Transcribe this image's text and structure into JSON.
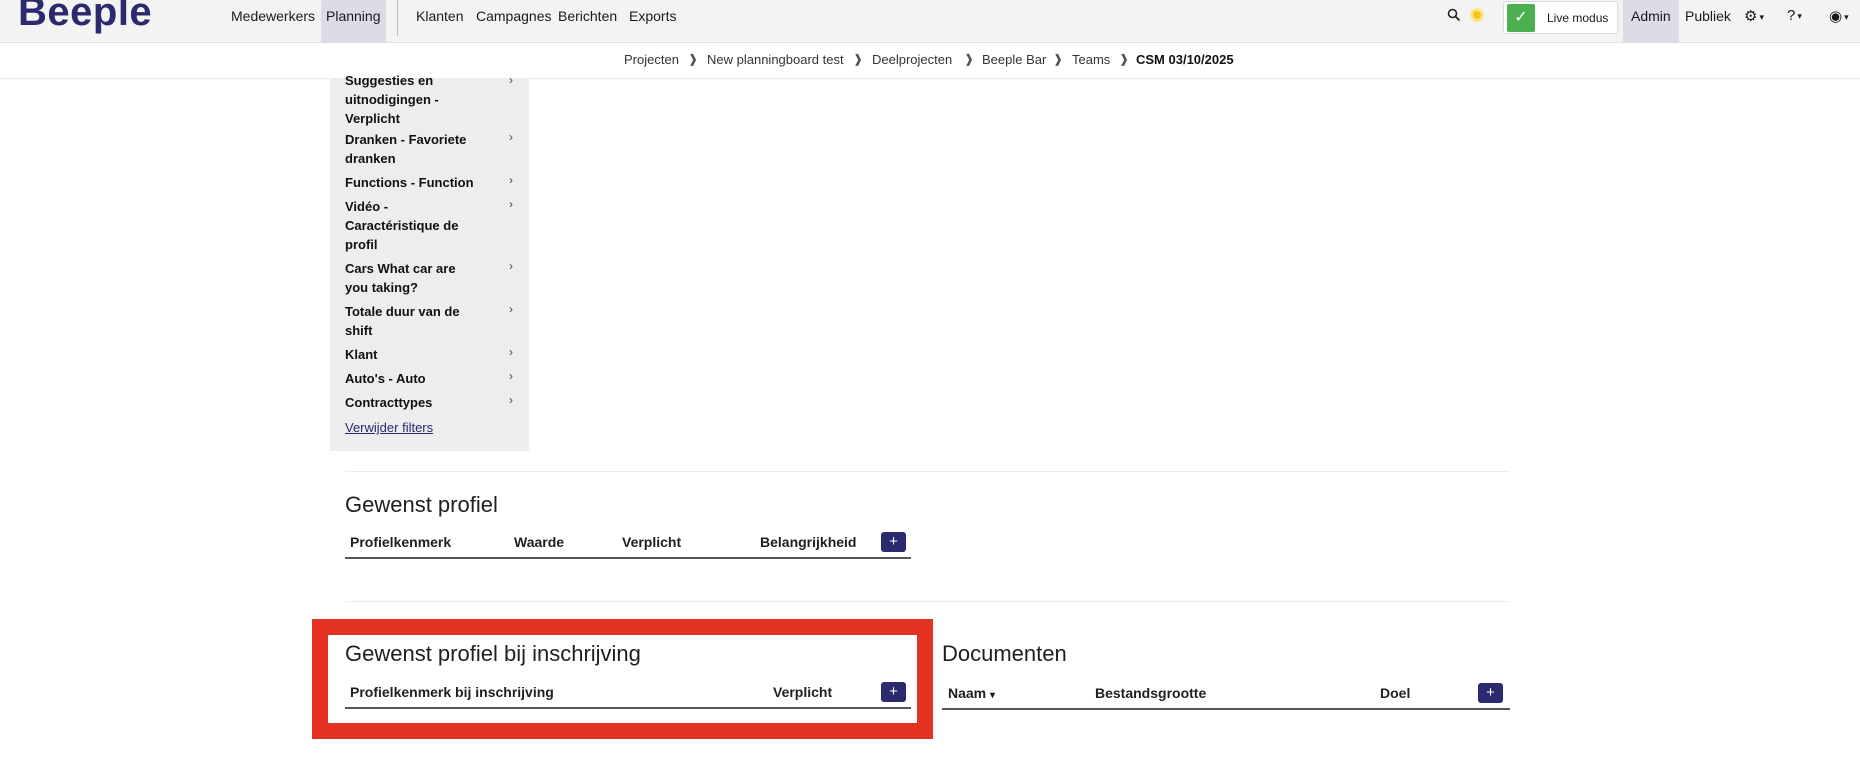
{
  "brand": {
    "logo_text": "Beeple"
  },
  "nav": {
    "items": [
      {
        "label": "Medewerkers"
      },
      {
        "label": "Planning"
      },
      {
        "label": "Klanten"
      },
      {
        "label": "Campagnes"
      },
      {
        "label": "Berichten"
      },
      {
        "label": "Exports"
      }
    ],
    "active": "Planning"
  },
  "topright": {
    "live_mode_label": "Live modus",
    "admin_label": "Admin",
    "public_label": "Publiek",
    "icons": [
      "search-icon",
      "sun-icon",
      "check-icon",
      "gear-icon",
      "help-icon",
      "user-icon"
    ]
  },
  "breadcrumb": {
    "items": [
      "Projecten",
      "New planningboard test",
      "Deelprojecten",
      "Beeple Bar",
      "Teams",
      "CSM 03/10/2025"
    ],
    "separator": "❱"
  },
  "filters": {
    "items": [
      {
        "line1": "Suggesties en",
        "line2": "uitnodigingen -",
        "line3": "Verplicht"
      },
      {
        "line1": "Dranken - Favoriete",
        "line2": "dranken"
      },
      {
        "line1": "Functions - Function"
      },
      {
        "line1": "Vidéo -",
        "line2": "Caractéristique de",
        "line3": "profil"
      },
      {
        "line1": "Cars What car are",
        "line2": "you taking?"
      },
      {
        "line1": "Totale duur van de",
        "line2": "shift"
      },
      {
        "line1": "Klant"
      },
      {
        "line1": "Auto's - Auto"
      },
      {
        "line1": "Contracttypes"
      }
    ],
    "chevron": "›",
    "remove_label": "Verwijder filters"
  },
  "gewenst_profiel": {
    "title": "Gewenst profiel",
    "columns": [
      "Profielkenmerk",
      "Waarde",
      "Verplicht",
      "Belangrijkheid"
    ],
    "add_label": "+"
  },
  "gewenst_profiel_inschrijving": {
    "title": "Gewenst profiel bij inschrijving",
    "columns": [
      "Profielkenmerk bij inschrijving",
      "Verplicht"
    ],
    "add_label": "+"
  },
  "documenten": {
    "title": "Documenten",
    "columns": [
      "Naam",
      "Bestandsgrootte",
      "Doel"
    ],
    "sort_indicator": "▾",
    "add_label": "+"
  },
  "colors": {
    "brand": "#2b2a6e",
    "highlight": "#e53222",
    "live_green": "#4caf50",
    "nav_bg": "#f3f3f4",
    "filter_bg": "#ededed"
  }
}
